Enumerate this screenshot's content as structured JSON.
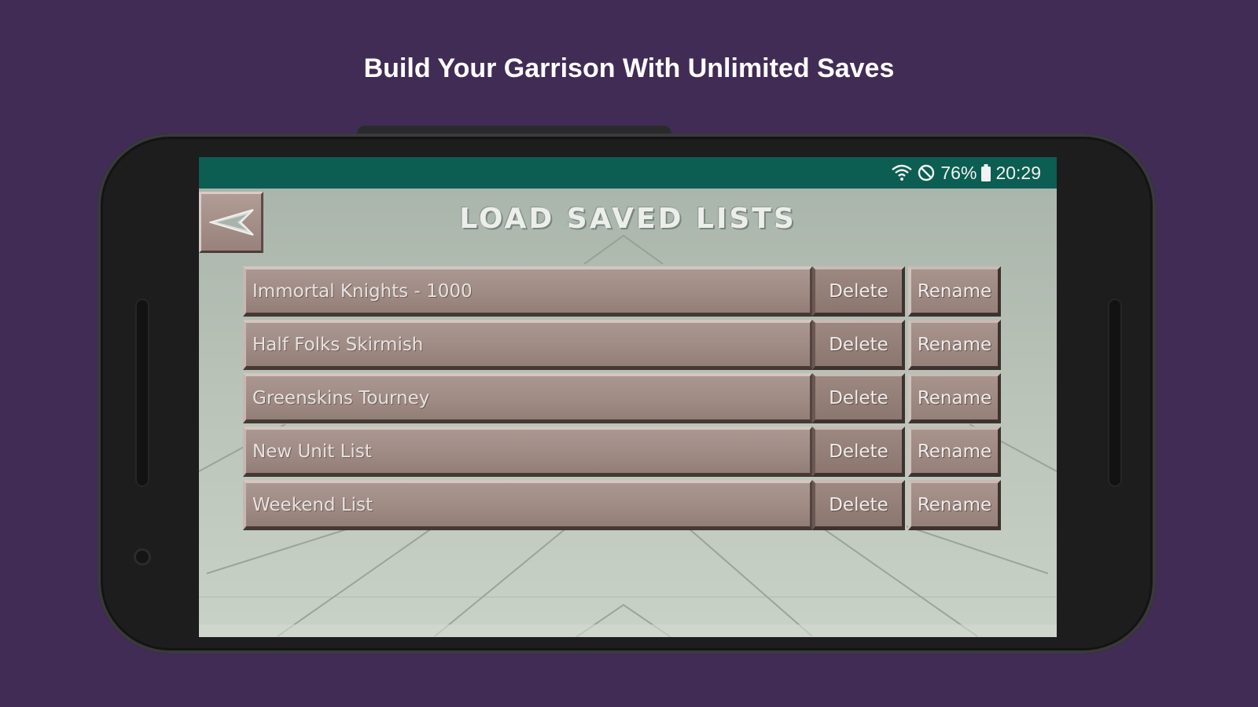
{
  "headline": "Build Your Garrison With Unlimited Saves",
  "status_bar": {
    "icons": [
      "wifi-icon",
      "do-not-disturb-icon",
      "battery-icon"
    ],
    "battery_percent": "76%",
    "time": "20:29"
  },
  "screen": {
    "title": "LOAD SAVED LISTS",
    "back_icon": "back-arrow-icon",
    "saved_lists": [
      {
        "name": "Immortal Knights - 1000",
        "delete_label": "Delete",
        "rename_label": "Rename"
      },
      {
        "name": "Half Folks Skirmish",
        "delete_label": "Delete",
        "rename_label": "Rename"
      },
      {
        "name": "Greenskins Tourney",
        "delete_label": "Delete",
        "rename_label": "Rename"
      },
      {
        "name": "New Unit List",
        "delete_label": "Delete",
        "rename_label": "Rename"
      },
      {
        "name": "Weekend List",
        "delete_label": "Delete",
        "rename_label": "Rename"
      }
    ]
  },
  "colors": {
    "background": "#412c55",
    "status_bar": "#0c5e52",
    "button": "#9e8983",
    "screen_bg": "#c7d0c5"
  }
}
